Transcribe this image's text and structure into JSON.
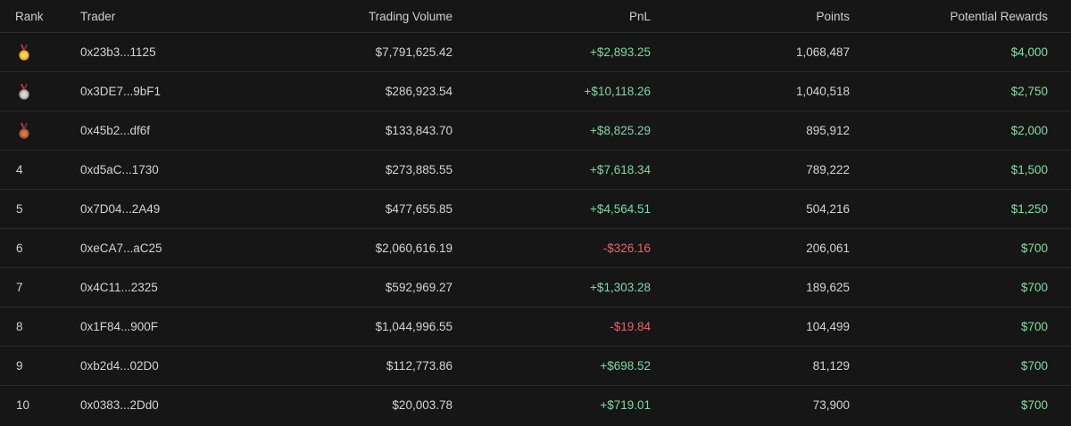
{
  "columns": {
    "rank": "Rank",
    "trader": "Trader",
    "volume": "Trading Volume",
    "pnl": "PnL",
    "points": "Points",
    "rewards": "Potential Rewards"
  },
  "colors": {
    "positive": "#7fd8a6",
    "negative": "#f0606a",
    "gold": "#e0a82e",
    "silver": "#b9b9b9",
    "bronze": "#b5562e"
  },
  "rows": [
    {
      "rank": "1",
      "medal": "gold-medal-icon",
      "trader": "0x23b3...1125",
      "volume": "$7,791,625.42",
      "pnl": "+$2,893.25",
      "pnl_sign": "pos",
      "points": "1,068,487",
      "rewards": "$4,000"
    },
    {
      "rank": "2",
      "medal": "silver-medal-icon",
      "trader": "0x3DE7...9bF1",
      "volume": "$286,923.54",
      "pnl": "+$10,118.26",
      "pnl_sign": "pos",
      "points": "1,040,518",
      "rewards": "$2,750"
    },
    {
      "rank": "3",
      "medal": "bronze-medal-icon",
      "trader": "0x45b2...df6f",
      "volume": "$133,843.70",
      "pnl": "+$8,825.29",
      "pnl_sign": "pos",
      "points": "895,912",
      "rewards": "$2,000"
    },
    {
      "rank": "4",
      "trader": "0xd5aC...1730",
      "volume": "$273,885.55",
      "pnl": "+$7,618.34",
      "pnl_sign": "pos",
      "points": "789,222",
      "rewards": "$1,500"
    },
    {
      "rank": "5",
      "trader": "0x7D04...2A49",
      "volume": "$477,655.85",
      "pnl": "+$4,564.51",
      "pnl_sign": "pos",
      "points": "504,216",
      "rewards": "$1,250"
    },
    {
      "rank": "6",
      "trader": "0xeCA7...aC25",
      "volume": "$2,060,616.19",
      "pnl": "-$326.16",
      "pnl_sign": "neg",
      "points": "206,061",
      "rewards": "$700"
    },
    {
      "rank": "7",
      "trader": "0x4C11...2325",
      "volume": "$592,969.27",
      "pnl": "+$1,303.28",
      "pnl_sign": "pos",
      "points": "189,625",
      "rewards": "$700"
    },
    {
      "rank": "8",
      "trader": "0x1F84...900F",
      "volume": "$1,044,996.55",
      "pnl": "-$19.84",
      "pnl_sign": "neg",
      "points": "104,499",
      "rewards": "$700"
    },
    {
      "rank": "9",
      "trader": "0xb2d4...02D0",
      "volume": "$112,773.86",
      "pnl": "+$698.52",
      "pnl_sign": "pos",
      "points": "81,129",
      "rewards": "$700"
    },
    {
      "rank": "10",
      "trader": "0x0383...2Dd0",
      "volume": "$20,003.78",
      "pnl": "+$719.01",
      "pnl_sign": "pos",
      "points": "73,900",
      "rewards": "$700"
    }
  ]
}
